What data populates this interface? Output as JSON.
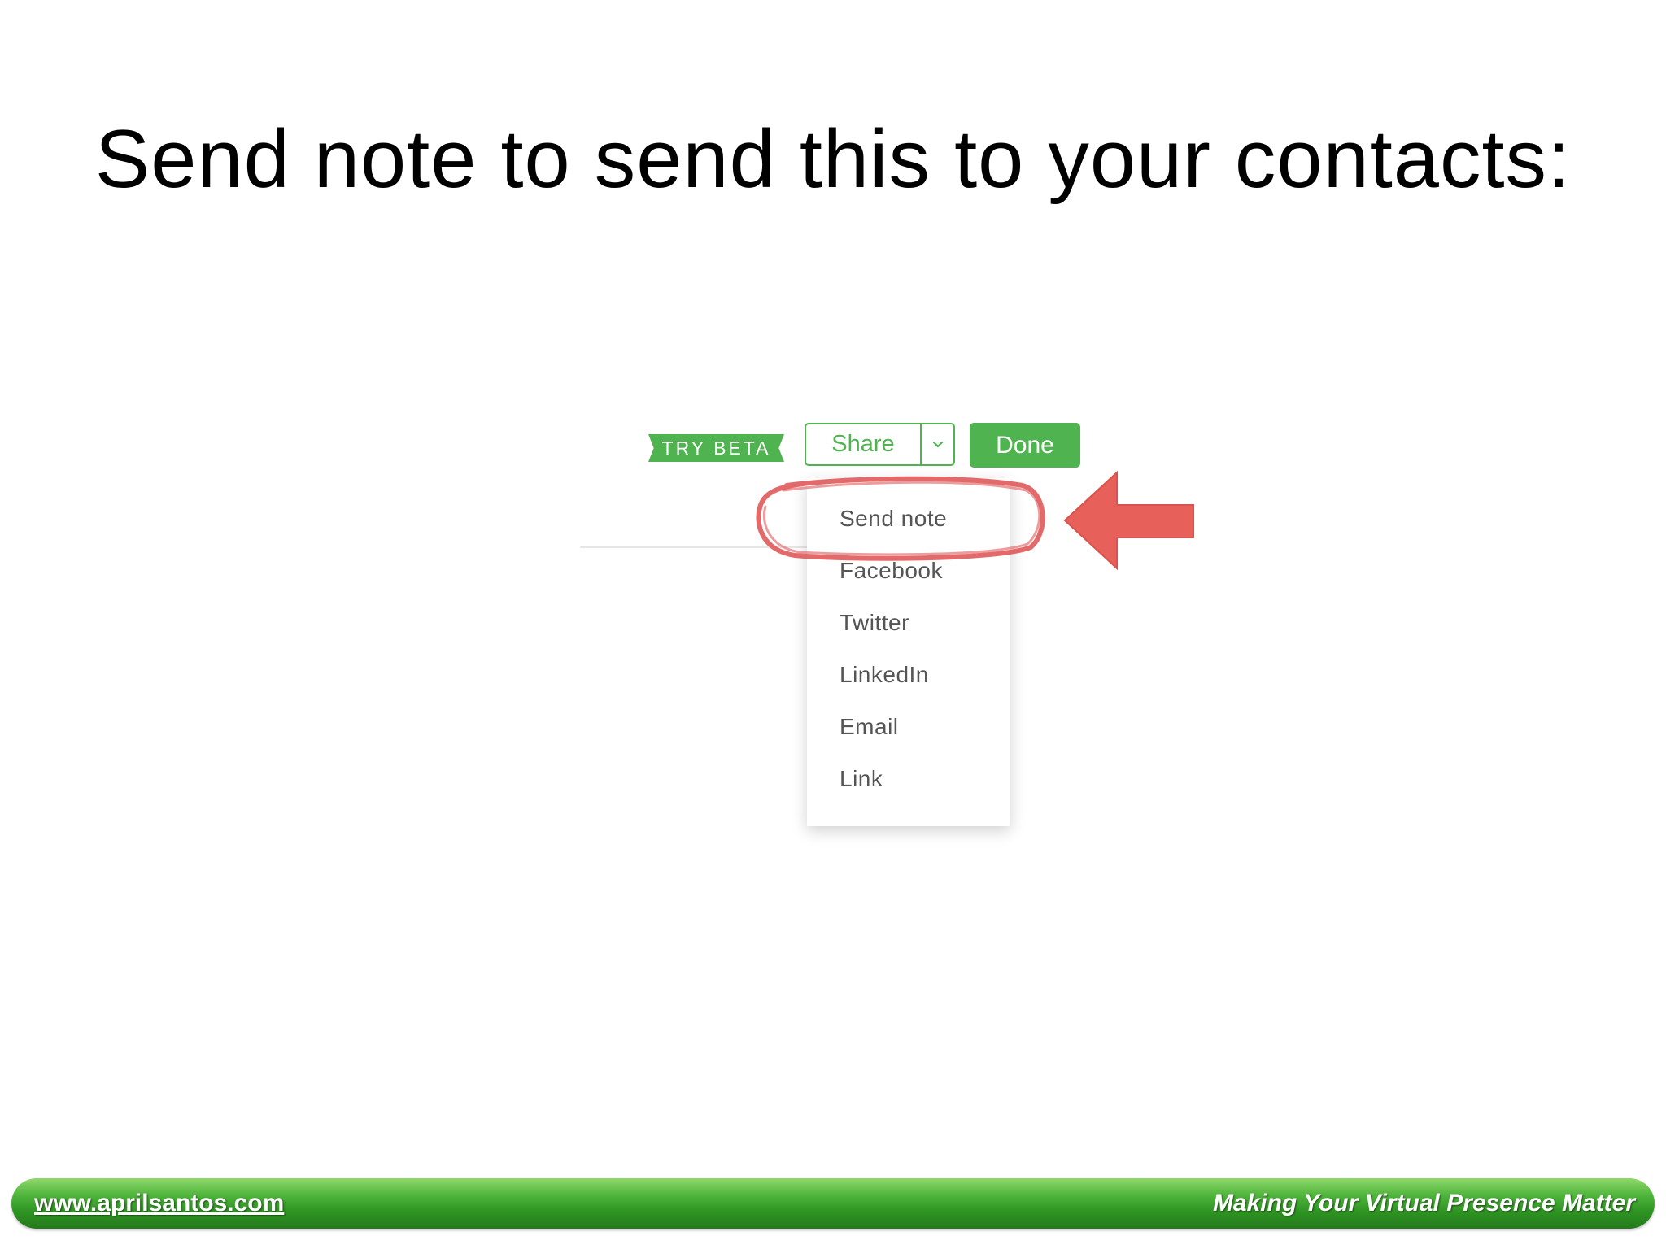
{
  "slide": {
    "title": "Send note to send this to your contacts:"
  },
  "toolbar": {
    "try_beta_label": "TRY BETA",
    "share_label": "Share",
    "share_dropdown_icon": "chevron-down-icon",
    "done_label": "Done",
    "accent_color": "#4fb34f"
  },
  "share_menu": {
    "items": [
      {
        "label": "Send note",
        "highlighted": true
      },
      {
        "label": "Facebook"
      },
      {
        "label": "Twitter"
      },
      {
        "label": "LinkedIn"
      },
      {
        "label": "Email"
      },
      {
        "label": "Link"
      }
    ]
  },
  "annotation": {
    "highlight_color": "#e05a5a",
    "arrow_color": "#e8605a",
    "arrow_icon": "arrow-left-icon"
  },
  "footer": {
    "url": "www.aprilsantos.com",
    "tagline": "Making Your Virtual Presence Matter",
    "bar_color": "#3ea52c"
  }
}
